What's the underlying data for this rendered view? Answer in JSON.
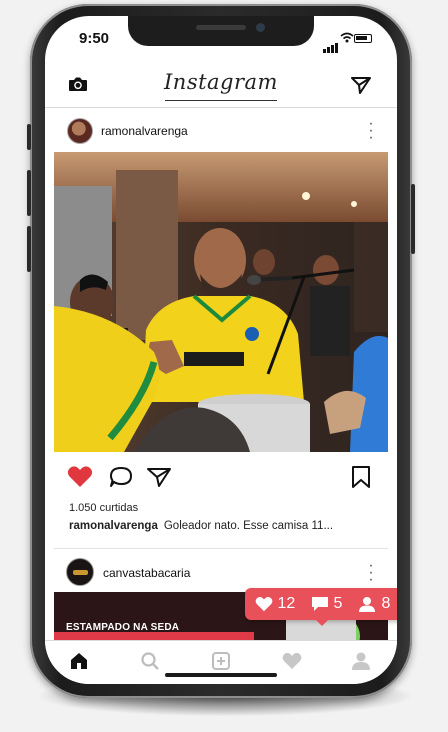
{
  "status_bar": {
    "time": "9:50"
  },
  "app": {
    "logo_text": "Instagram"
  },
  "post": {
    "username": "ramonalvarenga",
    "likes_text": "1.050 curtidas",
    "caption_user": "ramonalvarenga",
    "caption_text": "Goleador nato. Esse camisa 11..."
  },
  "post2": {
    "username": "canvastabacaria",
    "banner_text": "ESTAMPADO NA SEDA"
  },
  "notification": {
    "likes": "12",
    "comments": "5",
    "followers": "8",
    "color": "#e8505a"
  },
  "colors": {
    "like_red": "#e0383e"
  },
  "icons": [
    "camera-icon",
    "direct-send-icon",
    "more-options-icon",
    "heart-icon",
    "comment-icon",
    "share-icon",
    "bookmark-icon",
    "home-icon",
    "search-icon",
    "add-post-icon",
    "activity-icon",
    "profile-icon"
  ]
}
